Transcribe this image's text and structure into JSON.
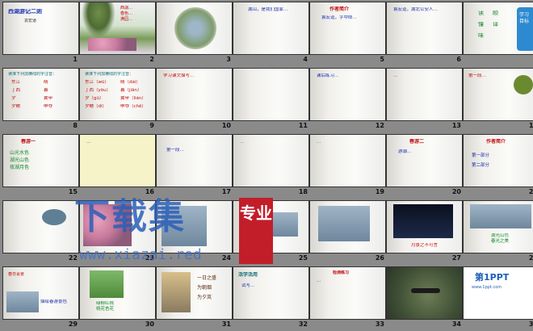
{
  "slides": [
    {
      "n": "1",
      "title": "西湖游记二则",
      "sub": "袁宏道"
    },
    {
      "n": "2",
      "text": "西湖…\n春色…\n满园…"
    },
    {
      "n": "3",
      "text": ""
    },
    {
      "n": "4",
      "text": "湖山，是我们国家…"
    },
    {
      "n": "5",
      "title": "作者简介",
      "text": "袁宏道，字中郎…"
    },
    {
      "n": "6",
      "text": "袁宏道，湖北公安人…"
    },
    {
      "n": "7",
      "items": [
        "读",
        "顺",
        "懂",
        "译",
        "味"
      ],
      "tag": "学习目标"
    },
    {
      "n": "8",
      "title": "读准下列加横线的字注音：",
      "rows": [
        "东江",
        "晴",
        "丁西",
        "暮",
        "夕",
        "翼甲",
        "夕鳃",
        "申夺"
      ]
    },
    {
      "n": "9",
      "title": "读准下列加横线的字注音：",
      "rows": [
        "东江（wǔ）",
        "晴（dài）",
        "丁西（yǒu）",
        "暮（jiān）",
        "夕（gǔ）",
        "翼甲（lián）",
        "夕鳃（dí）",
        "申夺（chē）"
      ]
    },
    {
      "n": "10",
      "text": "学习课文描写…"
    },
    {
      "n": "11",
      "text": ""
    },
    {
      "n": "12",
      "text": "课后练习…"
    },
    {
      "n": "13",
      "text": "…"
    },
    {
      "n": "14",
      "text": "第一段…"
    },
    {
      "n": "15",
      "title": "春游一",
      "text": "山光水色\n湖光山色\n夜湖月色"
    },
    {
      "n": "16",
      "text": "…"
    },
    {
      "n": "17",
      "text": "第一段…"
    },
    {
      "n": "18",
      "text": "…"
    },
    {
      "n": "19",
      "text": "…"
    },
    {
      "n": "20",
      "title": "春游二",
      "text": "游湖…"
    },
    {
      "n": "21",
      "title": "作者简介",
      "text": "第一部分\n第二部分"
    },
    {
      "n": "22",
      "text": ""
    },
    {
      "n": "23",
      "text": ""
    },
    {
      "n": "24",
      "text": ""
    },
    {
      "n": "25",
      "text": ""
    },
    {
      "n": "26",
      "text": ""
    },
    {
      "n": "27",
      "text": "月景之不可言"
    },
    {
      "n": "28",
      "text": "湖光山色\n春光之美"
    },
    {
      "n": "29",
      "title": "春日喜景",
      "text": "描绘春游景色"
    },
    {
      "n": "30",
      "text": "绿柳红桃\n桃花杏花"
    },
    {
      "n": "31",
      "text": "一日之盛\n为朝烟\n为夕岚"
    },
    {
      "n": "32",
      "title": "活学活用",
      "text": "试写…"
    },
    {
      "n": "33",
      "title": "检测练习",
      "text": "…"
    },
    {
      "n": "34",
      "text": ""
    },
    {
      "n": "35",
      "logo": "第1PPT",
      "text": "www.1ppt.com"
    }
  ],
  "watermark": {
    "big": "下载集",
    "url": "www.xiazai.red",
    "stamp": "专业"
  }
}
